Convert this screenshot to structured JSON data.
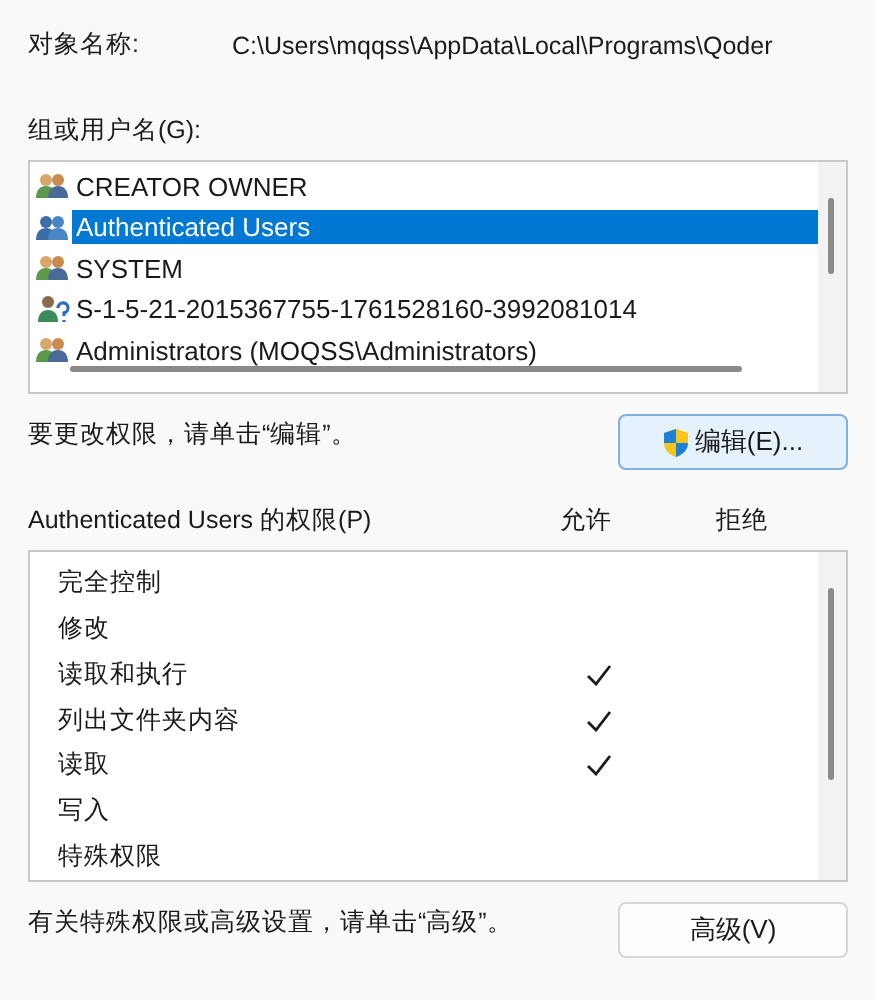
{
  "object_name": {
    "label": "对象名称:",
    "value": "C:\\Users\\mqqss\\AppData\\Local\\Programs\\Qoder"
  },
  "groups": {
    "label": "组或用户名(G):",
    "items": [
      {
        "name": "CREATOR OWNER",
        "kind": "group",
        "selected": false
      },
      {
        "name": "Authenticated Users",
        "kind": "users",
        "selected": true
      },
      {
        "name": "SYSTEM",
        "kind": "group",
        "selected": false
      },
      {
        "name": "S-1-5-21-2015367755-1761528160-3992081014",
        "kind": "unknown",
        "selected": false
      },
      {
        "name": "Administrators (MOQSS\\Administrators)",
        "kind": "group",
        "selected": false
      }
    ]
  },
  "edit_hint": "要更改权限，请单击“编辑”。",
  "edit_button": "编辑(E)...",
  "permissions": {
    "label": "Authenticated Users 的权限(P)",
    "columns": [
      "允许",
      "拒绝"
    ],
    "rows": [
      {
        "name": "完全控制",
        "allow": false,
        "deny": false
      },
      {
        "name": "修改",
        "allow": false,
        "deny": false
      },
      {
        "name": "读取和执行",
        "allow": true,
        "deny": false
      },
      {
        "name": "列出文件夹内容",
        "allow": true,
        "deny": false
      },
      {
        "name": "读取",
        "allow": true,
        "deny": false
      },
      {
        "name": "写入",
        "allow": false,
        "deny": false
      },
      {
        "name": "特殊权限",
        "allow": false,
        "deny": false
      }
    ]
  },
  "advanced_hint": "有关特殊权限或高级设置，请单击“高级”。",
  "advanced_button": "高级(V)"
}
